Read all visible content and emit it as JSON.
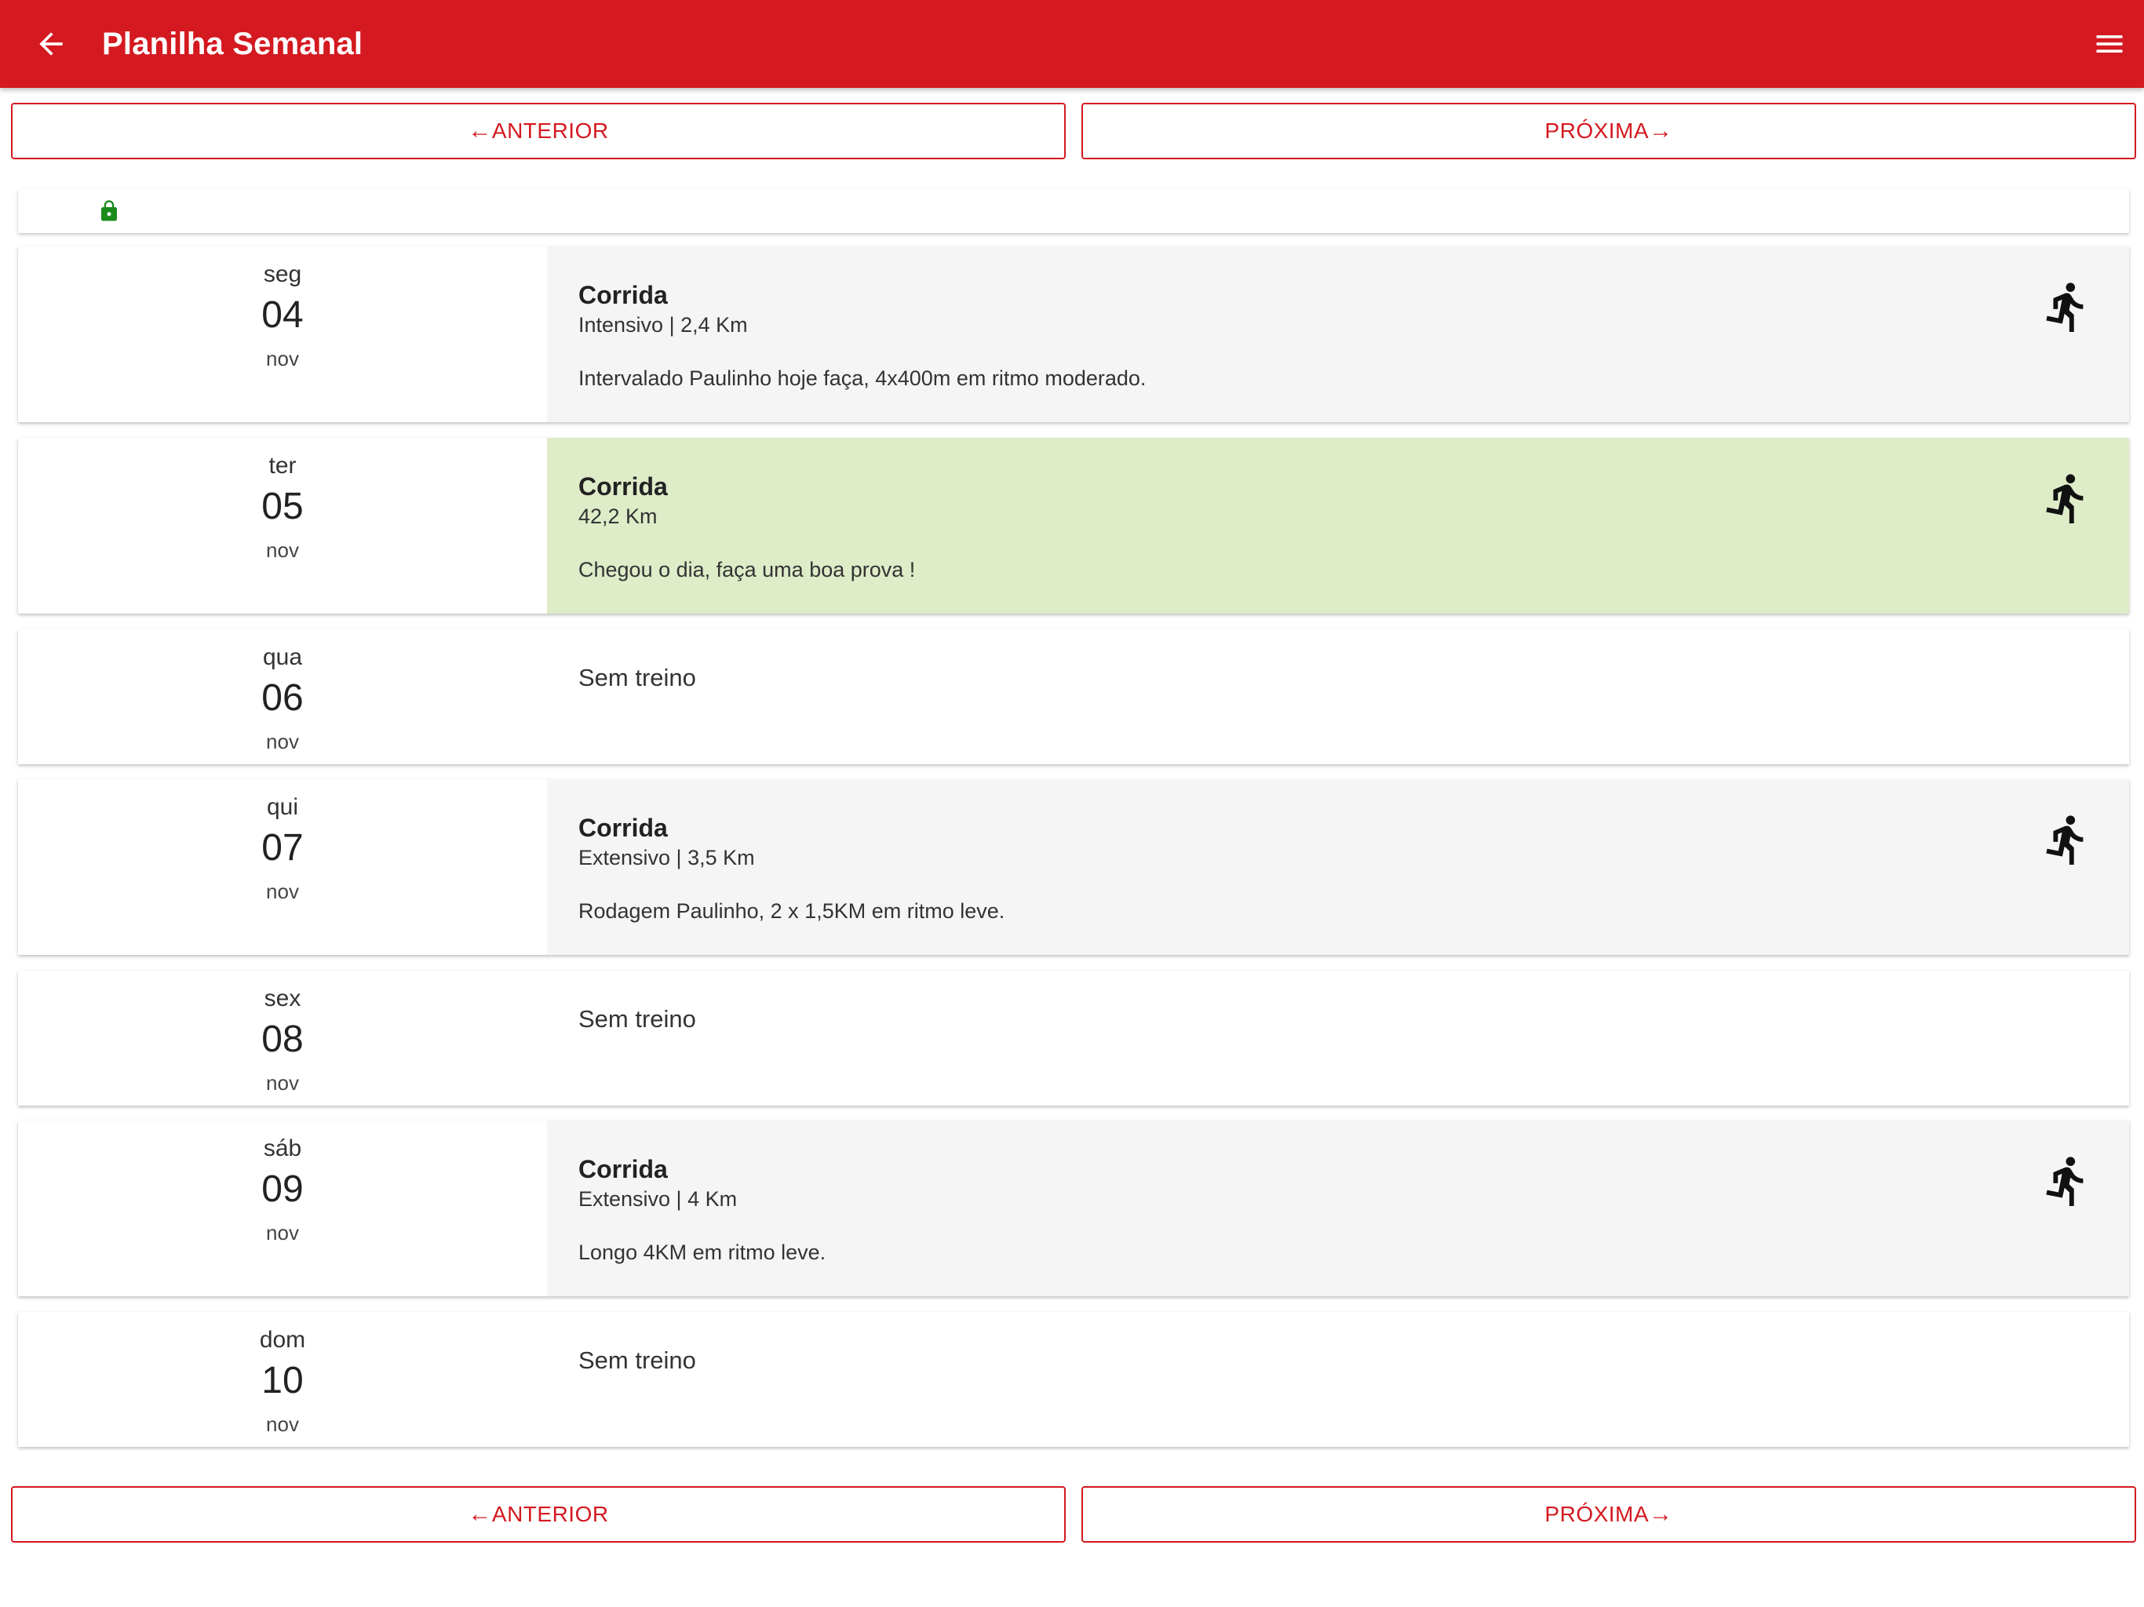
{
  "header": {
    "title": "Planilha Semanal",
    "back_icon": "arrow-left-icon",
    "menu_icon": "hamburger-menu-icon"
  },
  "nav": {
    "prev_label": "ANTERIOR",
    "next_label": "PRÓXIMA"
  },
  "lock": {
    "icon": "lock-icon",
    "color": "#1a8a1a"
  },
  "colors": {
    "brand": "#d41920",
    "shaded": "#f5f5f5",
    "highlight": "#deecc8"
  },
  "days": [
    {
      "dow": "seg",
      "day": "04",
      "month": "nov",
      "title": "Corrida",
      "subtitle": "Intensivo | 2,4 Km",
      "description": "Intervalado Paulinho hoje faça, 4x400m em ritmo moderado.",
      "icon": "running-person-icon"
    },
    {
      "dow": "ter",
      "day": "05",
      "month": "nov",
      "title": "Corrida",
      "subtitle": "42,2 Km",
      "description": "Chegou o dia, faça uma boa prova !",
      "icon": "running-person-icon"
    },
    {
      "dow": "qua",
      "day": "06",
      "month": "nov",
      "rest": "Sem treino"
    },
    {
      "dow": "qui",
      "day": "07",
      "month": "nov",
      "title": "Corrida",
      "subtitle": "Extensivo | 3,5 Km",
      "description": "Rodagem Paulinho, 2 x 1,5KM em ritmo leve.",
      "icon": "running-person-icon"
    },
    {
      "dow": "sex",
      "day": "08",
      "month": "nov",
      "rest": "Sem treino"
    },
    {
      "dow": "sáb",
      "day": "09",
      "month": "nov",
      "title": "Corrida",
      "subtitle": "Extensivo | 4 Km",
      "description": "Longo 4KM em ritmo leve.",
      "icon": "running-person-icon"
    },
    {
      "dow": "dom",
      "day": "10",
      "month": "nov",
      "rest": "Sem treino"
    }
  ]
}
